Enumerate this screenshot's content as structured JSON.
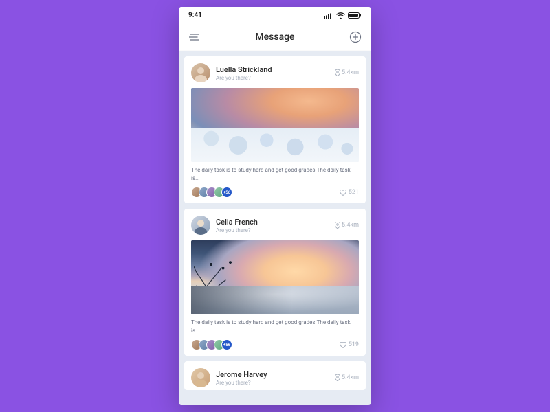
{
  "statusbar": {
    "time": "9:41"
  },
  "navbar": {
    "title": "Message"
  },
  "posts": [
    {
      "name": "Luella Strickland",
      "subtitle": "Are you there?",
      "distance": "5.4km",
      "caption": "The daily task is to study hard and get good grades.The daily task is...",
      "more_count": "+56",
      "likes": "521"
    },
    {
      "name": "Celia French",
      "subtitle": "Are you there?",
      "distance": "5.4km",
      "caption": "The daily task is to study hard and get good grades.The daily task is...",
      "more_count": "+56",
      "likes": "519"
    },
    {
      "name": "Jerome Harvey",
      "subtitle": "Are you there?",
      "distance": "5.4km"
    }
  ]
}
